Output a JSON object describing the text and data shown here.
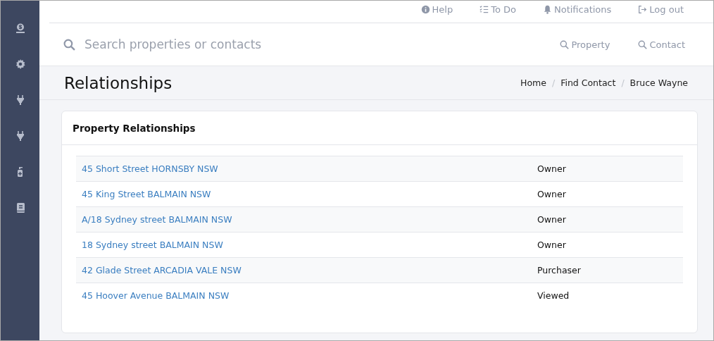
{
  "top_nav": [
    {
      "label": "Help",
      "kind": "info"
    },
    {
      "label": "To Do",
      "kind": "list"
    },
    {
      "label": "Notifications",
      "kind": "bell"
    },
    {
      "label": "Log out",
      "kind": "logout"
    }
  ],
  "search": {
    "placeholder": "Search properties or contacts",
    "filters": [
      "Property",
      "Contact"
    ]
  },
  "sidebar": {
    "items": [
      {
        "kind": "money"
      },
      {
        "kind": "gear"
      },
      {
        "kind": "plug"
      },
      {
        "kind": "plug"
      },
      {
        "kind": "bottle"
      },
      {
        "kind": "book"
      }
    ]
  },
  "page_title": "Relationships",
  "breadcrumb": [
    {
      "label": "Home",
      "kind": "link"
    },
    {
      "label": "/",
      "kind": "separator"
    },
    {
      "label": "Find Contact",
      "kind": "link"
    },
    {
      "label": "/",
      "kind": "separator"
    },
    {
      "label": "Bruce Wayne",
      "kind": "current"
    }
  ],
  "card": {
    "title": "Property Relationships",
    "rows": [
      {
        "property": "45 Short Street HORNSBY NSW",
        "relationship": "Owner"
      },
      {
        "property": "45 King Street BALMAIN NSW",
        "relationship": "Owner"
      },
      {
        "property": "A/18 Sydney street BALMAIN NSW",
        "relationship": "Owner"
      },
      {
        "property": "18 Sydney street BALMAIN NSW",
        "relationship": "Owner"
      },
      {
        "property": "42 Glade Street ARCADIA VALE NSW",
        "relationship": "Purchaser"
      },
      {
        "property": "45 Hoover Avenue BALMAIN NSW",
        "relationship": "Viewed"
      }
    ]
  }
}
